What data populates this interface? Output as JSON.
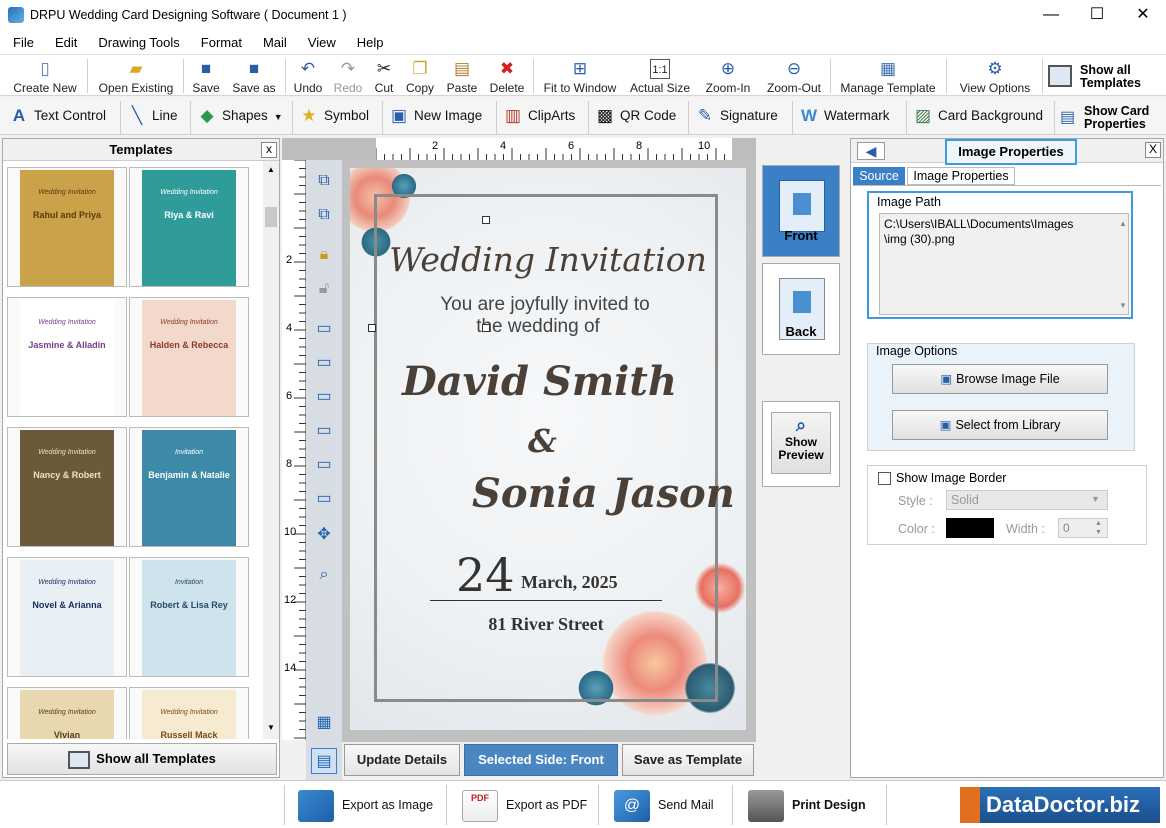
{
  "window": {
    "title": "DRPU Wedding Card Designing Software ( Document 1 )",
    "minimize": "—",
    "maximize": "☐",
    "close": "✕"
  },
  "menu": [
    "File",
    "Edit",
    "Drawing Tools",
    "Format",
    "Mail",
    "View",
    "Help"
  ],
  "toolbar": {
    "create_new": "Create New",
    "open_existing": "Open Existing",
    "save": "Save",
    "save_as": "Save as",
    "undo": "Undo",
    "redo": "Redo",
    "cut": "Cut",
    "copy": "Copy",
    "paste": "Paste",
    "delete": "Delete",
    "fit_to_window": "Fit to Window",
    "actual_size": "Actual Size",
    "zoom_in": "Zoom-In",
    "zoom_out": "Zoom-Out",
    "manage_template": "Manage Template",
    "view_options": "View Options",
    "show_all_templates": "Show all Templates"
  },
  "toolbar2": {
    "text_control": "Text Control",
    "line": "Line",
    "shapes": "Shapes",
    "symbol": "Symbol",
    "new_image": "New Image",
    "cliparts": "ClipArts",
    "qr_code": "QR Code",
    "signature": "Signature",
    "watermark": "Watermark",
    "card_background": "Card Background",
    "show_card_properties": "Show Card Properties"
  },
  "templates": {
    "title": "Templates",
    "close": "x",
    "items": [
      {
        "title": "Wedding Invitation",
        "names": "Rahul and Priya",
        "bg": "#c9a24a",
        "fg": "#5a3b0a"
      },
      {
        "title": "Wedding Invitation",
        "names": "Riya & Ravi",
        "bg": "#2f9c9a",
        "fg": "#ffffff"
      },
      {
        "title": "Wedding Invitation",
        "names": "Jasmine & Alladin",
        "bg": "#ffffff",
        "fg": "#7a3b8a"
      },
      {
        "title": "Wedding Invitation",
        "names": "Halden & Rebecca",
        "bg": "#f3d9cc",
        "fg": "#8a3b2a"
      },
      {
        "title": "Wedding Invitation",
        "names": "Nancy & Robert",
        "bg": "#6b5a3a",
        "fg": "#f1e2b8"
      },
      {
        "title": "Invitation",
        "names": "Benjamin & Natalie",
        "bg": "#3d8aa8",
        "fg": "#ffffff"
      },
      {
        "title": "Wedding Invitation",
        "names": "Novel & Arianna",
        "bg": "#e8f0f6",
        "fg": "#1b2b5a"
      },
      {
        "title": "Invitation",
        "names": "Robert & Lisa Rey",
        "bg": "#cfe3ec",
        "fg": "#2a4a6a"
      },
      {
        "title": "Wedding Invitation",
        "names": "Vivian",
        "bg": "#e8d8b0",
        "fg": "#5a3b1a"
      },
      {
        "title": "Wedding Invitation",
        "names": "Russell Mack",
        "bg": "#f6ead0",
        "fg": "#7a4a1a"
      }
    ],
    "show_all_button": "Show all Templates"
  },
  "ruler": {
    "h_ticks": [
      "2",
      "4",
      "6",
      "8",
      "10"
    ],
    "v_ticks": [
      "2",
      "4",
      "6",
      "8",
      "10",
      "12",
      "14"
    ]
  },
  "card": {
    "heading": "Wedding Invitation",
    "invite_line1": "You are joyfully invited to",
    "invite_line2": "the wedding of",
    "groom": "David Smith",
    "amp": "&",
    "bride": "Sonia Jason",
    "day": "24",
    "month_year": "March, 2025",
    "address": "81 River Street"
  },
  "side": {
    "front": "Front",
    "back": "Back",
    "show_preview": "Show Preview"
  },
  "canvas_actions": {
    "update_details": "Update Details",
    "selected_side": "Selected Side: Front",
    "save_as_template": "Save as Template"
  },
  "properties": {
    "title": "Image Properties",
    "close": "X",
    "tab_source": "Source",
    "tab_image_properties": "Image Properties",
    "image_path_label": "Image Path",
    "image_path_value": "C:\\Users\\IBALL\\Documents\\Images\n\\img (30).png",
    "image_options_label": "Image Options",
    "browse_button": "Browse Image File",
    "library_button": "Select from Library",
    "show_border_label": "Show Image Border",
    "style_label": "Style :",
    "style_value": "Solid",
    "color_label": "Color :",
    "color_value": "#000000",
    "width_label": "Width :",
    "width_value": "0"
  },
  "footer": {
    "export_image": "Export as Image",
    "export_pdf": "Export as PDF",
    "send_mail": "Send Mail",
    "print_design": "Print Design",
    "brand": "DataDoctor.biz"
  },
  "colors": {
    "accent": "#3b7fc4",
    "selected_side_bg": "#4a86c2",
    "front_bg": "#3b7fc4"
  }
}
